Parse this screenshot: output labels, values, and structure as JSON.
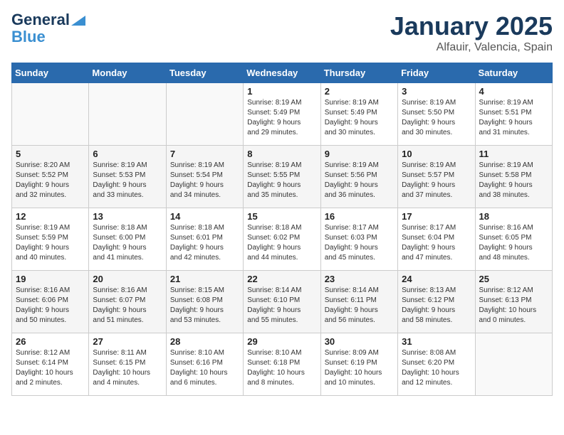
{
  "logo": {
    "line1": "General",
    "line2": "Blue"
  },
  "title": "January 2025",
  "subtitle": "Alfauir, Valencia, Spain",
  "weekdays": [
    "Sunday",
    "Monday",
    "Tuesday",
    "Wednesday",
    "Thursday",
    "Friday",
    "Saturday"
  ],
  "weeks": [
    [
      {
        "day": "",
        "info": ""
      },
      {
        "day": "",
        "info": ""
      },
      {
        "day": "",
        "info": ""
      },
      {
        "day": "1",
        "info": "Sunrise: 8:19 AM\nSunset: 5:49 PM\nDaylight: 9 hours\nand 29 minutes."
      },
      {
        "day": "2",
        "info": "Sunrise: 8:19 AM\nSunset: 5:49 PM\nDaylight: 9 hours\nand 30 minutes."
      },
      {
        "day": "3",
        "info": "Sunrise: 8:19 AM\nSunset: 5:50 PM\nDaylight: 9 hours\nand 30 minutes."
      },
      {
        "day": "4",
        "info": "Sunrise: 8:19 AM\nSunset: 5:51 PM\nDaylight: 9 hours\nand 31 minutes."
      }
    ],
    [
      {
        "day": "5",
        "info": "Sunrise: 8:20 AM\nSunset: 5:52 PM\nDaylight: 9 hours\nand 32 minutes."
      },
      {
        "day": "6",
        "info": "Sunrise: 8:19 AM\nSunset: 5:53 PM\nDaylight: 9 hours\nand 33 minutes."
      },
      {
        "day": "7",
        "info": "Sunrise: 8:19 AM\nSunset: 5:54 PM\nDaylight: 9 hours\nand 34 minutes."
      },
      {
        "day": "8",
        "info": "Sunrise: 8:19 AM\nSunset: 5:55 PM\nDaylight: 9 hours\nand 35 minutes."
      },
      {
        "day": "9",
        "info": "Sunrise: 8:19 AM\nSunset: 5:56 PM\nDaylight: 9 hours\nand 36 minutes."
      },
      {
        "day": "10",
        "info": "Sunrise: 8:19 AM\nSunset: 5:57 PM\nDaylight: 9 hours\nand 37 minutes."
      },
      {
        "day": "11",
        "info": "Sunrise: 8:19 AM\nSunset: 5:58 PM\nDaylight: 9 hours\nand 38 minutes."
      }
    ],
    [
      {
        "day": "12",
        "info": "Sunrise: 8:19 AM\nSunset: 5:59 PM\nDaylight: 9 hours\nand 40 minutes."
      },
      {
        "day": "13",
        "info": "Sunrise: 8:18 AM\nSunset: 6:00 PM\nDaylight: 9 hours\nand 41 minutes."
      },
      {
        "day": "14",
        "info": "Sunrise: 8:18 AM\nSunset: 6:01 PM\nDaylight: 9 hours\nand 42 minutes."
      },
      {
        "day": "15",
        "info": "Sunrise: 8:18 AM\nSunset: 6:02 PM\nDaylight: 9 hours\nand 44 minutes."
      },
      {
        "day": "16",
        "info": "Sunrise: 8:17 AM\nSunset: 6:03 PM\nDaylight: 9 hours\nand 45 minutes."
      },
      {
        "day": "17",
        "info": "Sunrise: 8:17 AM\nSunset: 6:04 PM\nDaylight: 9 hours\nand 47 minutes."
      },
      {
        "day": "18",
        "info": "Sunrise: 8:16 AM\nSunset: 6:05 PM\nDaylight: 9 hours\nand 48 minutes."
      }
    ],
    [
      {
        "day": "19",
        "info": "Sunrise: 8:16 AM\nSunset: 6:06 PM\nDaylight: 9 hours\nand 50 minutes."
      },
      {
        "day": "20",
        "info": "Sunrise: 8:16 AM\nSunset: 6:07 PM\nDaylight: 9 hours\nand 51 minutes."
      },
      {
        "day": "21",
        "info": "Sunrise: 8:15 AM\nSunset: 6:08 PM\nDaylight: 9 hours\nand 53 minutes."
      },
      {
        "day": "22",
        "info": "Sunrise: 8:14 AM\nSunset: 6:10 PM\nDaylight: 9 hours\nand 55 minutes."
      },
      {
        "day": "23",
        "info": "Sunrise: 8:14 AM\nSunset: 6:11 PM\nDaylight: 9 hours\nand 56 minutes."
      },
      {
        "day": "24",
        "info": "Sunrise: 8:13 AM\nSunset: 6:12 PM\nDaylight: 9 hours\nand 58 minutes."
      },
      {
        "day": "25",
        "info": "Sunrise: 8:12 AM\nSunset: 6:13 PM\nDaylight: 10 hours\nand 0 minutes."
      }
    ],
    [
      {
        "day": "26",
        "info": "Sunrise: 8:12 AM\nSunset: 6:14 PM\nDaylight: 10 hours\nand 2 minutes."
      },
      {
        "day": "27",
        "info": "Sunrise: 8:11 AM\nSunset: 6:15 PM\nDaylight: 10 hours\nand 4 minutes."
      },
      {
        "day": "28",
        "info": "Sunrise: 8:10 AM\nSunset: 6:16 PM\nDaylight: 10 hours\nand 6 minutes."
      },
      {
        "day": "29",
        "info": "Sunrise: 8:10 AM\nSunset: 6:18 PM\nDaylight: 10 hours\nand 8 minutes."
      },
      {
        "day": "30",
        "info": "Sunrise: 8:09 AM\nSunset: 6:19 PM\nDaylight: 10 hours\nand 10 minutes."
      },
      {
        "day": "31",
        "info": "Sunrise: 8:08 AM\nSunset: 6:20 PM\nDaylight: 10 hours\nand 12 minutes."
      },
      {
        "day": "",
        "info": ""
      }
    ]
  ]
}
